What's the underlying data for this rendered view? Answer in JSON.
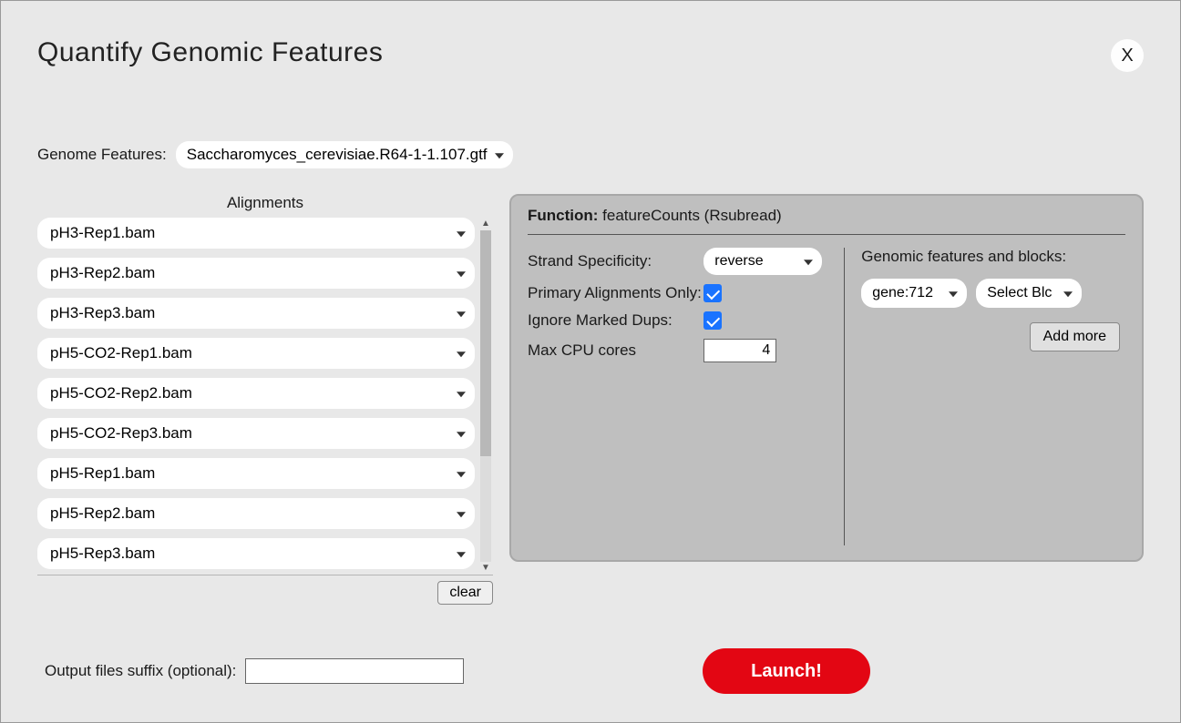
{
  "title": "Quantify Genomic Features",
  "close_label": "X",
  "genome_features": {
    "label": "Genome Features:",
    "value": "Saccharomyces_cerevisiae.R64-1-1.107.gtf"
  },
  "alignments": {
    "heading": "Alignments",
    "items": [
      "pH3-Rep1.bam",
      "pH3-Rep2.bam",
      "pH3-Rep3.bam",
      "pH5-CO2-Rep1.bam",
      "pH5-CO2-Rep2.bam",
      "pH5-CO2-Rep3.bam",
      "pH5-Rep1.bam",
      "pH5-Rep2.bam",
      "pH5-Rep3.bam"
    ],
    "clear_label": "clear"
  },
  "panel": {
    "func_prefix": "Function:",
    "func_name": "featureCounts (Rsubread)",
    "left": {
      "strand_label": "Strand Specificity:",
      "strand_value": "reverse",
      "primary_label": "Primary Alignments Only:",
      "primary_checked": true,
      "dups_label": "Ignore Marked Dups:",
      "dups_checked": true,
      "cpu_label": "Max CPU cores",
      "cpu_value": "4"
    },
    "right": {
      "heading": "Genomic features and blocks:",
      "feature_value": "gene:712",
      "block_value": "Select Blc",
      "add_more_label": "Add more"
    }
  },
  "output_suffix_label": "Output files suffix (optional):",
  "output_suffix_value": "",
  "launch_label": "Launch!"
}
